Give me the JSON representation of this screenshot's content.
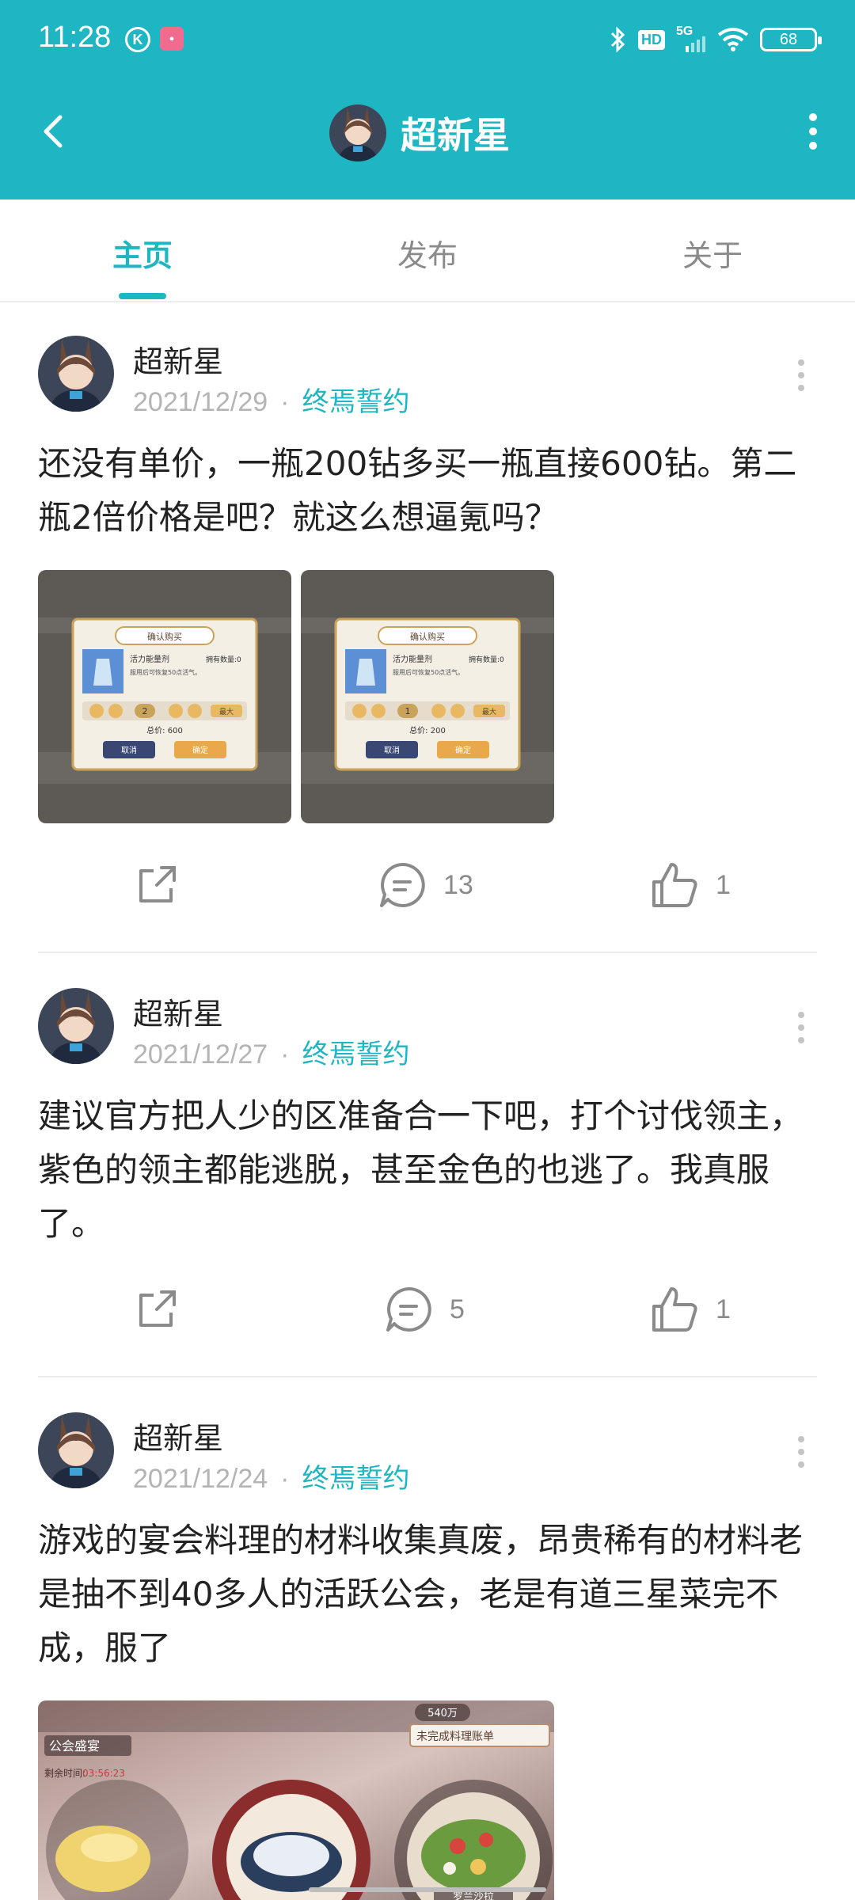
{
  "status_bar": {
    "time": "11:28",
    "k_icon": "K",
    "app_icon": "Lofter",
    "hd": "HD",
    "network": "5G",
    "battery": "68"
  },
  "appbar": {
    "title": "超新星",
    "back_icon": "back-arrow-icon",
    "more_icon": "more-vertical-icon"
  },
  "tabs": [
    {
      "label": "主页",
      "active": true
    },
    {
      "label": "发布",
      "active": false
    },
    {
      "label": "关于",
      "active": false
    }
  ],
  "colors": {
    "accent": "#1eb6c3",
    "muted": "#b4b4b4",
    "text": "#222222"
  },
  "posts": [
    {
      "author": "超新星",
      "date": "2021/12/29",
      "dot": "·",
      "tag": "终焉誓约",
      "content": "还没有单价，一瓶200钻多买一瓶直接600钻。第二瓶2倍价格是吧？就这么想逼氪吗？",
      "images": [
        {
          "dialog_title": "确认购买",
          "item_name": "活力能量剂",
          "owned_label": "拥有数量:0",
          "desc": "服用后可恢复50点活气。",
          "qty": "2",
          "total": "总价: 600",
          "cancel": "取消",
          "confirm": "确定",
          "max": "最大"
        },
        {
          "dialog_title": "确认购买",
          "item_name": "活力能量剂",
          "owned_label": "拥有数量:0",
          "desc": "服用后可恢复50点活气。",
          "qty": "1",
          "total": "总价: 200",
          "cancel": "取消",
          "confirm": "确定",
          "max": "最大"
        }
      ],
      "comments": "13",
      "likes": "1"
    },
    {
      "author": "超新星",
      "date": "2021/12/27",
      "dot": "·",
      "tag": "终焉誓约",
      "content": "建议官方把人少的区准备合一下吧，打个讨伐领主，紫色的领主都能逃脱，甚至金色的也逃了。我真服了。",
      "comments": "5",
      "likes": "1"
    },
    {
      "author": "超新星",
      "date": "2021/12/24",
      "dot": "·",
      "tag": "终焉誓约",
      "content": "游戏的宴会料理的材料收集真废，昂贵稀有的材料老是抽不到40多人的活跃公会，老是有道三星菜完不成，服了",
      "image": {
        "guild_label": "公会盛宴",
        "countdown_label": "剩余时间:",
        "countdown": "03:56:23",
        "currency": "540万",
        "banner": "未完成料理账单",
        "dish_label": "罗兰沙拉"
      }
    }
  ]
}
